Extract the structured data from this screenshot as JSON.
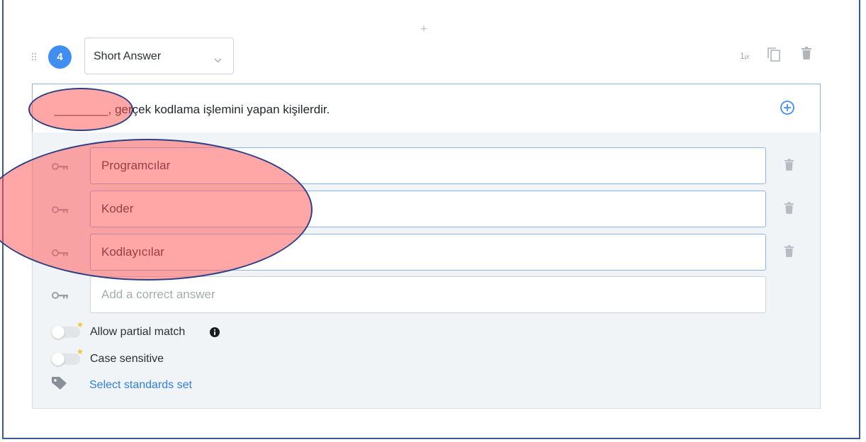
{
  "question": {
    "number": "4",
    "type_label": "Short Answer",
    "points_value": "1",
    "points_unit": "pt",
    "text": "________, gerçek kodlama işlemini yapan kişilerdir."
  },
  "answers": [
    {
      "value": "Programcılar"
    },
    {
      "value": "Koder"
    },
    {
      "value": "Kodlayıcılar"
    }
  ],
  "new_answer": {
    "placeholder": "Add a correct answer"
  },
  "options": {
    "partial_match_label": "Allow partial match",
    "case_sensitive_label": "Case sensitive",
    "partial_match_on": false,
    "case_sensitive_on": false
  },
  "standards": {
    "link_label": "Select standards set"
  },
  "icons": {
    "add_block": "plus-icon",
    "drag": "drag-handle-icon",
    "dropdown": "chevron-down-icon",
    "duplicate": "copy-icon",
    "delete": "trash-icon",
    "add_blank": "plus-circle-icon",
    "answer_key": "key-icon",
    "premium": "star-icon",
    "info": "info-icon",
    "tag": "tag-icon"
  },
  "colors": {
    "accent": "#3f8ef0",
    "link": "#2f7de1",
    "panel_bg": "#f1f4f6",
    "annotation_fill": "#ff5050",
    "annotation_stroke": "#2d3f86"
  }
}
